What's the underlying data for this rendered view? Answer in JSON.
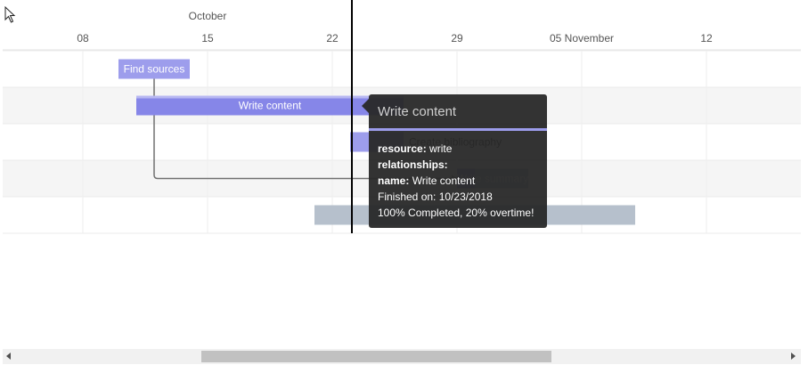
{
  "chart_data": {
    "type": "gantt",
    "x_type": "date",
    "x_range": [
      "2018-10-03",
      "2018-11-16"
    ],
    "month_label": "October",
    "ticks": [
      {
        "date": "2018-10-08",
        "label": "08"
      },
      {
        "date": "2018-10-15",
        "label": "15"
      },
      {
        "date": "2018-10-22",
        "label": "22"
      },
      {
        "date": "2018-10-29",
        "label": "29"
      },
      {
        "date": "2018-11-05",
        "label": "05 November"
      },
      {
        "date": "2018-11-12",
        "label": "12"
      }
    ],
    "current_date": "2018-10-23",
    "tasks": [
      {
        "name": "Find sources",
        "start": "2018-10-10",
        "end": "2018-10-14",
        "completed": 1.0
      },
      {
        "name": "Write content",
        "start": "2018-10-11",
        "end": "2018-10-26",
        "completed": 1.0,
        "highlighted": true
      },
      {
        "name": "Create bibliography",
        "start": "2018-10-23",
        "end": "2018-10-26",
        "completed": 1.0
      },
      {
        "name": "Write summary",
        "start": "2018-10-29",
        "end": "2018-11-02",
        "completed": 0.25
      },
      {
        "name": "",
        "start": "2018-10-21",
        "end": "2018-11-08",
        "completed": 0.0
      }
    ],
    "dependencies": [
      {
        "from": "Find sources",
        "to": "Write summary"
      }
    ],
    "colors": {
      "complete": "#9d9dec",
      "complete_highlight": "#8686e8",
      "incomplete": "#b6c0cc",
      "row_alt": "#f5f5f5",
      "current_line": "#000000",
      "dependency": "#707070"
    }
  },
  "tooltip": {
    "title": "Write content",
    "resource_label": "resource:",
    "resource_value": "write",
    "relationships_label": "relationships:",
    "name_label": "name:",
    "name_value": "Write content",
    "finished": "Finished on: 10/23/2018",
    "completion": "100% Completed, 20% overtime!"
  }
}
